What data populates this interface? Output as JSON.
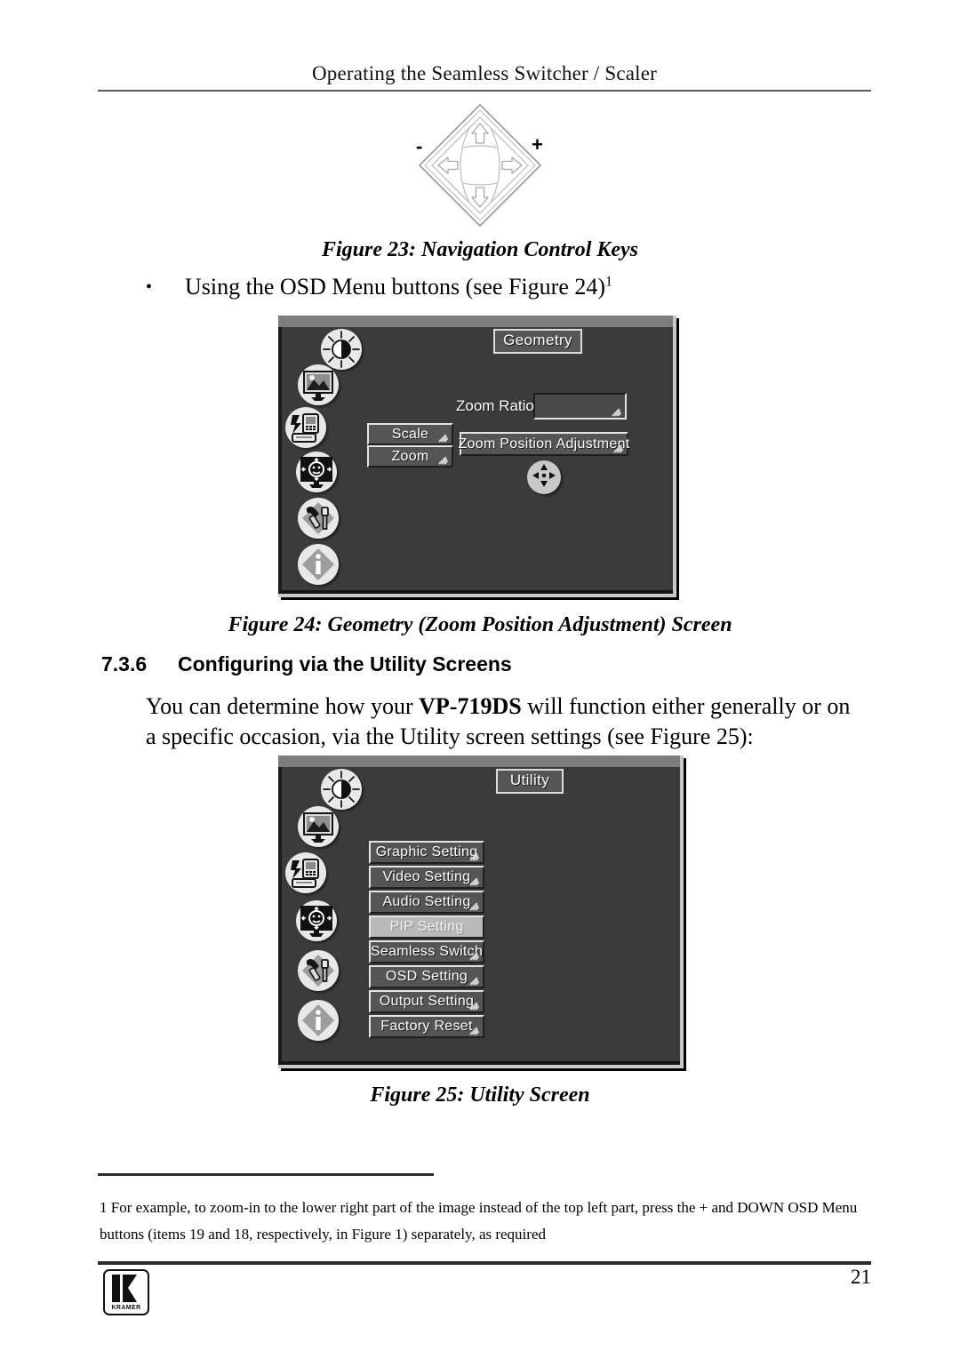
{
  "header": {
    "running_title": "Operating the Seamless Switcher / Scaler"
  },
  "figures": {
    "fig23_caption": "Figure 23: Navigation Control Keys",
    "fig24_caption": "Figure 24: Geometry (Zoom Position Adjustment) Screen",
    "fig25_caption": "Figure 25: Utility Screen"
  },
  "nav_keys": {
    "minus_label": "-",
    "plus_label": "+",
    "up_icon": "arrow-up-icon",
    "down_icon": "arrow-down-icon",
    "left_icon": "arrow-left-icon",
    "right_icon": "arrow-right-icon"
  },
  "bullet": {
    "marker": "•",
    "text": "Using the OSD Menu buttons (see Figure 24)",
    "footnote_ref": "1"
  },
  "section": {
    "number": "7.3.6",
    "title": "Configuring via the Utility Screens"
  },
  "body": {
    "para_part1": "You can determine how your ",
    "para_model": "VP-719DS",
    "para_part2": " will function either generally or on a specific occasion, via the Utility screen settings (see Figure 25):"
  },
  "geometry_screen": {
    "title": "Geometry",
    "zoom_ratio_label": "Zoom Ratio",
    "zoom_ratio_value": "",
    "buttons": [
      {
        "label": "Scale",
        "selected": false
      },
      {
        "label": "Zoom",
        "selected": false
      }
    ],
    "zoom_position_button": "Zoom Position Adjustment",
    "fourway_icon": "four-way-arrows-icon",
    "sidebar_icons": [
      "brightness-contrast-icon",
      "picture-image-icon",
      "input-source-icon",
      "geometry-position-icon",
      "utility-tools-icon",
      "information-icon"
    ]
  },
  "utility_screen": {
    "title": "Utility",
    "menu_items": [
      {
        "label": "Graphic Setting",
        "selected": false
      },
      {
        "label": "Video Setting",
        "selected": false
      },
      {
        "label": "Audio Setting",
        "selected": false
      },
      {
        "label": "PIP Setting",
        "selected": true
      },
      {
        "label": "Seamless Switch",
        "selected": false
      },
      {
        "label": "OSD Setting",
        "selected": false
      },
      {
        "label": "Output Setting",
        "selected": false
      },
      {
        "label": "Factory Reset",
        "selected": false
      }
    ],
    "sidebar_icons": [
      "brightness-contrast-icon",
      "picture-image-icon",
      "input-source-icon",
      "geometry-position-icon",
      "utility-tools-icon",
      "information-icon"
    ]
  },
  "footnote": {
    "marker": "1",
    "text": "For example, to zoom-in to the lower right part of the image instead of the top left part, press the + and DOWN OSD Menu buttons (items 19 and 18, respectively, in Figure 1) separately, as required"
  },
  "footer": {
    "logo_word": "KRAMER",
    "page_number": "21"
  },
  "colors": {
    "osd_background": "#3b3b3b",
    "osd_titlebar": "#7d7d7d",
    "osd_button_face": "#555555",
    "osd_button_selected": "#b9b9b9",
    "osd_bevel_light": "#e4e4e4",
    "osd_bevel_dark": "#1e1e1e",
    "text_on_osd": "#ffffff",
    "page_text": "#000000"
  }
}
